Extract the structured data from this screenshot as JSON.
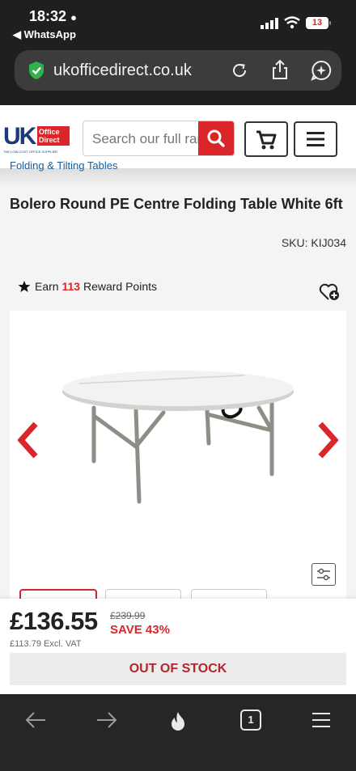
{
  "status_bar": {
    "time": "18:32",
    "back_app": "◀ WhatsApp",
    "battery": "13"
  },
  "browser": {
    "url": "ukofficedirect.co.uk"
  },
  "site": {
    "logo_uk": "UK",
    "logo_office": "Office",
    "logo_direct": "Direct",
    "logo_tagline": "THE LOW-COST OFFICE SUPPLIER",
    "search_placeholder": "Search our full range"
  },
  "breadcrumb": "Folding & Tilting Tables",
  "product": {
    "title": "Bolero Round PE Centre Folding Table White 6ft",
    "sku": "SKU: KIJ034",
    "reward_prefix": "Earn ",
    "reward_points": "113",
    "reward_suffix": " Reward Points",
    "price": "£136.55",
    "was_price": "£239.99",
    "save": "SAVE 43%",
    "ex_vat": "£113.79 Excl. VAT",
    "stock_button": "OUT OF STOCK"
  },
  "toolbar": {
    "tabs_count": "1"
  },
  "colors": {
    "brand_red": "#d9262b",
    "brand_blue": "#1a3a78"
  }
}
